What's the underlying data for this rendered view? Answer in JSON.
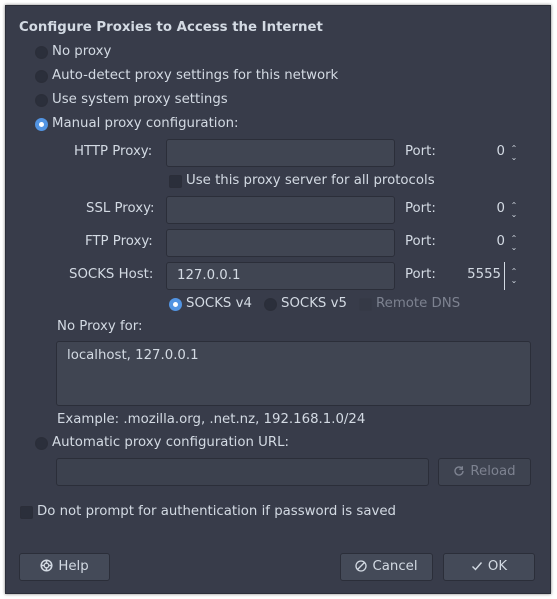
{
  "heading": "Configure Proxies to Access the Internet",
  "modes": {
    "no_proxy": "No proxy",
    "auto_detect": "Auto-detect proxy settings for this network",
    "system": "Use system proxy settings",
    "manual": "Manual proxy configuration:",
    "selected": "manual"
  },
  "http": {
    "label": "HTTP Proxy:",
    "value": "",
    "port_label": "Port:",
    "port": "0"
  },
  "share_all": {
    "label": "Use this proxy server for all protocols",
    "checked": false
  },
  "ssl": {
    "label": "SSL Proxy:",
    "value": "",
    "port_label": "Port:",
    "port": "0"
  },
  "ftp": {
    "label": "FTP Proxy:",
    "value": "",
    "port_label": "Port:",
    "port": "0"
  },
  "socks": {
    "label": "SOCKS Host:",
    "value": "127.0.0.1",
    "port_label": "Port:",
    "port": "5555",
    "v4_label": "SOCKS v4",
    "v5_label": "SOCKS v5",
    "selected_version": "v4",
    "remote_dns_label": "Remote DNS"
  },
  "no_proxy_for": {
    "label": "No Proxy for:",
    "value": "localhost, 127.0.0.1",
    "example": "Example: .mozilla.org, .net.nz, 192.168.1.0/24"
  },
  "auto_config": {
    "label": "Automatic proxy configuration URL:",
    "value": "",
    "reload_label": "Reload"
  },
  "no_prompt_auth": {
    "label": "Do not prompt for authentication if password is saved",
    "checked": false
  },
  "buttons": {
    "help": "Help",
    "cancel": "Cancel",
    "ok": "OK"
  },
  "colors": {
    "background": "#383c4a",
    "entry": "#404552",
    "accent": "#5294e2",
    "text": "#d3dae3"
  }
}
